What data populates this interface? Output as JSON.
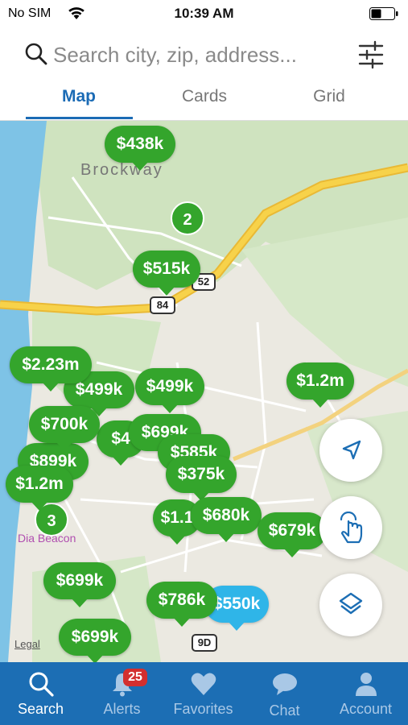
{
  "status_bar": {
    "carrier": "No SIM",
    "time": "10:39 AM"
  },
  "search": {
    "placeholder": "Search city, zip, address..."
  },
  "tabs": [
    {
      "label": "Map",
      "active": true
    },
    {
      "label": "Cards",
      "active": false
    },
    {
      "label": "Grid",
      "active": false
    }
  ],
  "map": {
    "town_label": "Brockway",
    "town_label_2": "Dia Beacon",
    "legal_label": "Legal",
    "route_shields": [
      "84",
      "52",
      "9D"
    ],
    "pins": [
      {
        "price": "$438k",
        "selected": false
      },
      {
        "price": "$515k",
        "selected": false
      },
      {
        "price": "$2.23m",
        "selected": false
      },
      {
        "price": "$499k",
        "selected": false
      },
      {
        "price": "$499k",
        "selected": false
      },
      {
        "price": "$1.2m",
        "selected": false
      },
      {
        "price": "$700k",
        "selected": false
      },
      {
        "price": "$4",
        "selected": false
      },
      {
        "price": "$699k",
        "selected": false
      },
      {
        "price": "$585k",
        "selected": false
      },
      {
        "price": "$899k",
        "selected": false
      },
      {
        "price": "$375k",
        "selected": false
      },
      {
        "price": "$1.2m",
        "selected": false
      },
      {
        "price": "$1.1",
        "selected": false
      },
      {
        "price": "$680k",
        "selected": false
      },
      {
        "price": "$679k",
        "selected": false
      },
      {
        "price": "$699k",
        "selected": false
      },
      {
        "price": "$786k",
        "selected": false
      },
      {
        "price": "$550k",
        "selected": true
      },
      {
        "price": "$699k",
        "selected": false
      }
    ],
    "clusters": [
      "2",
      "3"
    ]
  },
  "map_controls": [
    {
      "icon": "location-arrow-icon"
    },
    {
      "icon": "draw-hand-icon"
    },
    {
      "icon": "layers-icon"
    }
  ],
  "bottom_nav": [
    {
      "label": "Search",
      "icon": "search-icon",
      "active": true
    },
    {
      "label": "Alerts",
      "icon": "bell-icon",
      "active": false,
      "badge": "25"
    },
    {
      "label": "Favorites",
      "icon": "heart-icon",
      "active": false
    },
    {
      "label": "Chat",
      "icon": "chat-icon",
      "active": false
    },
    {
      "label": "Account",
      "icon": "person-icon",
      "active": false
    }
  ],
  "colors": {
    "brand_blue": "#1c6eb4",
    "pin_green": "#34a52c",
    "pin_selected": "#2fb5e8",
    "badge_red": "#d32f2f"
  }
}
